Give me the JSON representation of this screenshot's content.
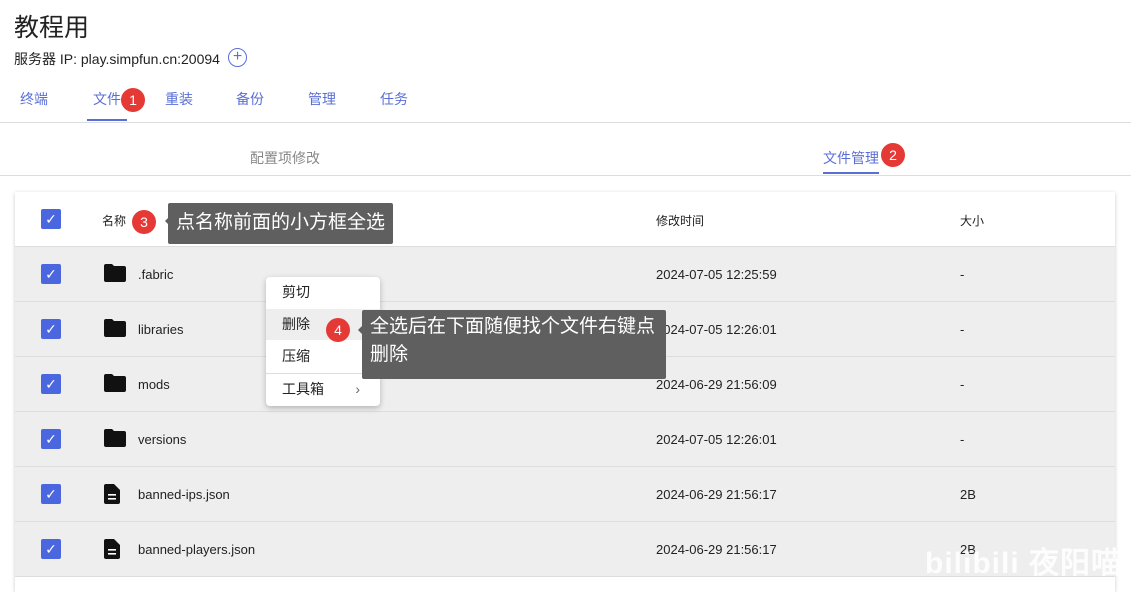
{
  "header": {
    "title": "教程用",
    "ip_label": "服务器 IP: play.simpfun.cn:20094"
  },
  "tabs": [
    "终端",
    "文件",
    "重装",
    "备份",
    "管理",
    "任务"
  ],
  "subtabs": [
    "配置项修改",
    "文件管理"
  ],
  "table": {
    "columns": [
      "名称",
      "修改时间",
      "大小"
    ],
    "rows": [
      {
        "name": ".fabric",
        "type": "folder",
        "modified": "2024-07-05 12:25:59",
        "size": "-"
      },
      {
        "name": "libraries",
        "type": "folder",
        "modified": "2024-07-05 12:26:01",
        "size": "-"
      },
      {
        "name": "mods",
        "type": "folder",
        "modified": "2024-06-29 21:56:09",
        "size": "-"
      },
      {
        "name": "versions",
        "type": "folder",
        "modified": "2024-07-05 12:26:01",
        "size": "-"
      },
      {
        "name": "banned-ips.json",
        "type": "file",
        "modified": "2024-06-29 21:56:17",
        "size": "2B"
      },
      {
        "name": "banned-players.json",
        "type": "file",
        "modified": "2024-06-29 21:56:17",
        "size": "2B"
      }
    ]
  },
  "context_menu": [
    "剪切",
    "删除",
    "压缩",
    "工具箱"
  ],
  "annotations": {
    "b1": "1",
    "b2": "2",
    "b3": "3",
    "b4": "4",
    "tip3": "点名称前面的小方框全选",
    "tip4": "全选后在下面随便找个文件右键点删除"
  },
  "watermark": "bilibili 夜阳喵",
  "colors": {
    "accent": "#5a6fd6",
    "badge": "#e53935",
    "checkbox": "#4a67e0"
  }
}
